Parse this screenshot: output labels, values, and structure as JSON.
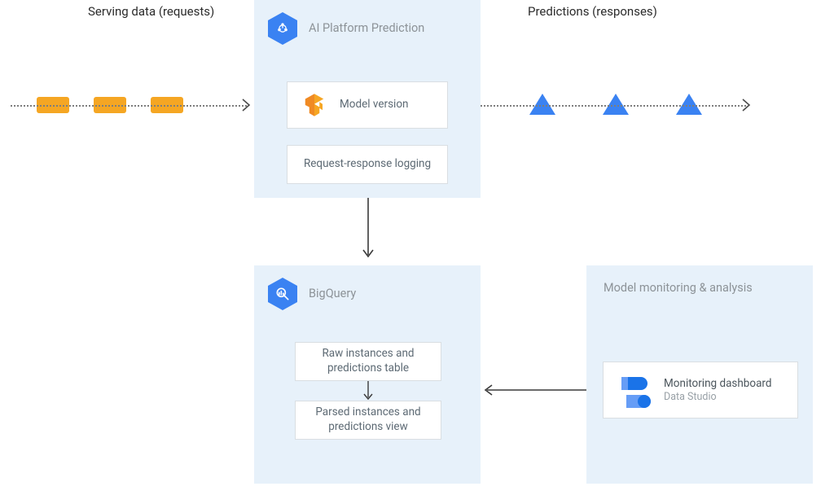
{
  "labels": {
    "serving": "Serving data (requests)",
    "predictions": "Predictions (responses)"
  },
  "aiplatform": {
    "title": "AI Platform Prediction",
    "model_version": "Model version",
    "rr_logging": "Request-response logging"
  },
  "bigquery": {
    "title": "BigQuery",
    "raw": "Raw instances and predictions table",
    "parsed": "Parsed instances and predictions view"
  },
  "monitoring": {
    "title": "Model monitoring & analysis",
    "dashboard": "Monitoring dashboard",
    "sub": "Data Studio"
  }
}
